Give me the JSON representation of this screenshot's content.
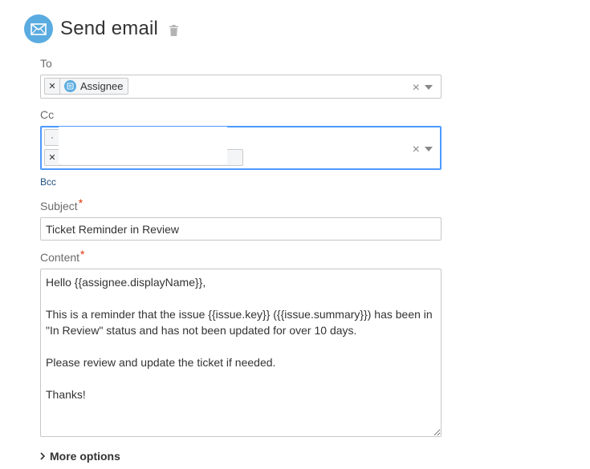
{
  "header": {
    "title": "Send email",
    "icon": "envelope-icon",
    "delete_icon": "trash-icon",
    "accent": "#5aabe0"
  },
  "to": {
    "label": "To",
    "tags": [
      {
        "label": "Assignee",
        "icon": "user-field-icon"
      }
    ],
    "clear": "×"
  },
  "cc": {
    "label": "Cc",
    "clear": "×"
  },
  "bcc": {
    "label": "Bcc"
  },
  "subject": {
    "label": "Subject",
    "required": "*",
    "value": "Ticket Reminder in Review"
  },
  "content": {
    "label": "Content",
    "required": "*",
    "value": "Hello {{assignee.displayName}},\n\nThis is a reminder that the issue {{issue.key}} ({{issue.summary}}) has been in \"In Review\" status and has not been updated for over 10 days.\n\nPlease review and update the ticket if needed.\n\nThanks!"
  },
  "more_options": {
    "label": "More options"
  }
}
